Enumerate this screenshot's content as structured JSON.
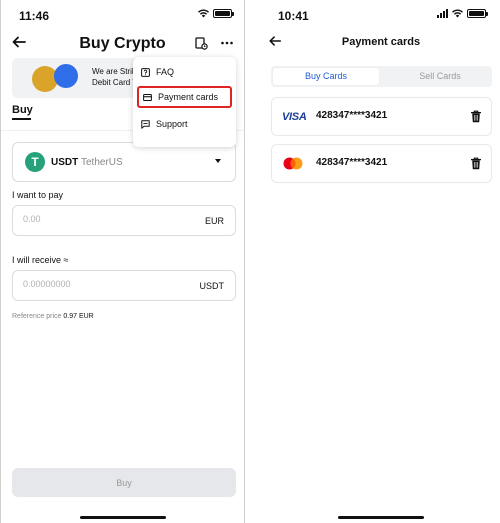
{
  "left": {
    "status": {
      "time": "11:46"
    },
    "header": {
      "title": "Buy Crypto"
    },
    "promo": {
      "line1": "We are Strik",
      "line2": "Debit Card T"
    },
    "tab": "Buy",
    "menu": [
      {
        "label": "FAQ",
        "icon": "question-icon"
      },
      {
        "label": "Payment cards",
        "icon": "card-icon"
      },
      {
        "label": "Support",
        "icon": "chat-icon"
      }
    ],
    "asset": {
      "code": "USDT",
      "name": "TetherUS",
      "icon_letter": "T"
    },
    "pay": {
      "label": "I want to pay",
      "placeholder": "0.00",
      "unit": "EUR"
    },
    "receive": {
      "label": "I will receive ≈",
      "placeholder": "0.00000000",
      "unit": "USDT"
    },
    "reference": {
      "label": "Reference price",
      "value": "0.97 EUR"
    },
    "buy_button": "Buy"
  },
  "right": {
    "status": {
      "time": "10:41"
    },
    "header": {
      "title": "Payment cards"
    },
    "tabs": [
      {
        "label": "Buy Cards",
        "active": true
      },
      {
        "label": "Sell Cards",
        "active": false
      }
    ],
    "cards": [
      {
        "brand": "VISA",
        "number": "428347****3421"
      },
      {
        "brand": "mastercard",
        "number": "428347****3421"
      }
    ]
  },
  "colors": {
    "accent": "#1e5bd8",
    "highlight": "#e02323",
    "tether": "#26a17b",
    "visa": "#1a3d96",
    "mc_red": "#eb001b",
    "mc_orange": "#f79e1b"
  }
}
